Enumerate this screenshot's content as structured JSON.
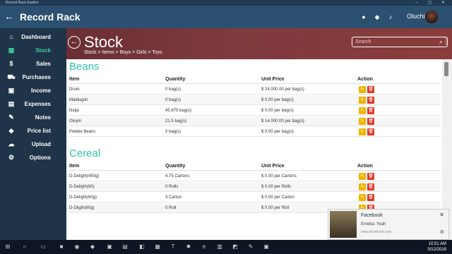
{
  "window": {
    "title": "Record Rack Epsilon"
  },
  "appbar": {
    "title": "Record Rack",
    "user_name": "Oluchi"
  },
  "sidebar": {
    "items": [
      {
        "label": "Dashboard",
        "icon": "home-icon",
        "glyph": "⌂"
      },
      {
        "label": "Stock",
        "icon": "cubes-icon",
        "glyph": "▦",
        "active": true
      },
      {
        "label": "Sales",
        "icon": "dollar-icon",
        "glyph": "$"
      },
      {
        "label": "Purchases",
        "icon": "cart-icon",
        "glyph": "⛟"
      },
      {
        "label": "Income",
        "icon": "money-icon",
        "glyph": "▣"
      },
      {
        "label": "Expenses",
        "icon": "cards-icon",
        "glyph": "▤"
      },
      {
        "label": "Notes",
        "icon": "pin-icon",
        "glyph": "✎"
      },
      {
        "label": "Price list",
        "icon": "tag-icon",
        "glyph": "◆"
      },
      {
        "label": "Upload",
        "icon": "cloud-upload-icon",
        "glyph": "☁"
      },
      {
        "label": "Options",
        "icon": "gear-icon",
        "glyph": "⚙"
      }
    ]
  },
  "banner": {
    "title": "Stock",
    "breadcrumb": "Stock  >  Items  >  Boys  >  Girls  >  Toys",
    "search_placeholder": "Search"
  },
  "sections": [
    {
      "title": "Beans",
      "headers": [
        "Item",
        "Quantity",
        "Unit Price",
        "Action"
      ],
      "rows": [
        [
          "Drum",
          "0 bag(s)",
          "$ 24,000.00 per bag(s)"
        ],
        [
          "Maiduguri",
          "0 bag(s)",
          "$ 0.00 per bag(s)"
        ],
        [
          "Naija",
          "45.875 bag(s)",
          "$ 0.00 per bag(s)"
        ],
        [
          "Oloyin",
          "21.5 bag(s)",
          "$ 14,000.00 per bag(s)"
        ],
        [
          "Pelebe Beans",
          "0 bag(s)",
          "$ 0.00 per bag(s)"
        ]
      ]
    },
    {
      "title": "Cereal",
      "headers": [
        "Item",
        "Quantity",
        "Unit Price",
        "Action"
      ],
      "rows": [
        [
          "D-Deligth(450g)",
          "4.75 Cartons",
          "$ 0.00 per Cartons"
        ],
        [
          "D-Deligth(60)",
          "0 Rolls",
          "$ 0.00 per Rolls"
        ],
        [
          "D-Deligth(60g)",
          "3 Carton",
          "$ 0.00 per Carton"
        ],
        [
          "D-Dligth(60g)",
          "0 Roll",
          "$ 0.00 per Roll"
        ]
      ]
    }
  ],
  "toast": {
    "app": "Facebook",
    "message": "Emeka: Yeah",
    "source": "www.facebook.com"
  },
  "taskbar": {
    "time": "10:51 AM",
    "date": "3/12/2018"
  },
  "colors": {
    "accent": "#2fc4a6",
    "sidebar_active": "#3ad09a",
    "edit_button": "#f0b400",
    "delete_button": "#e03a2a",
    "appbar": "#2b5070",
    "banner": "#7d3a3e"
  }
}
